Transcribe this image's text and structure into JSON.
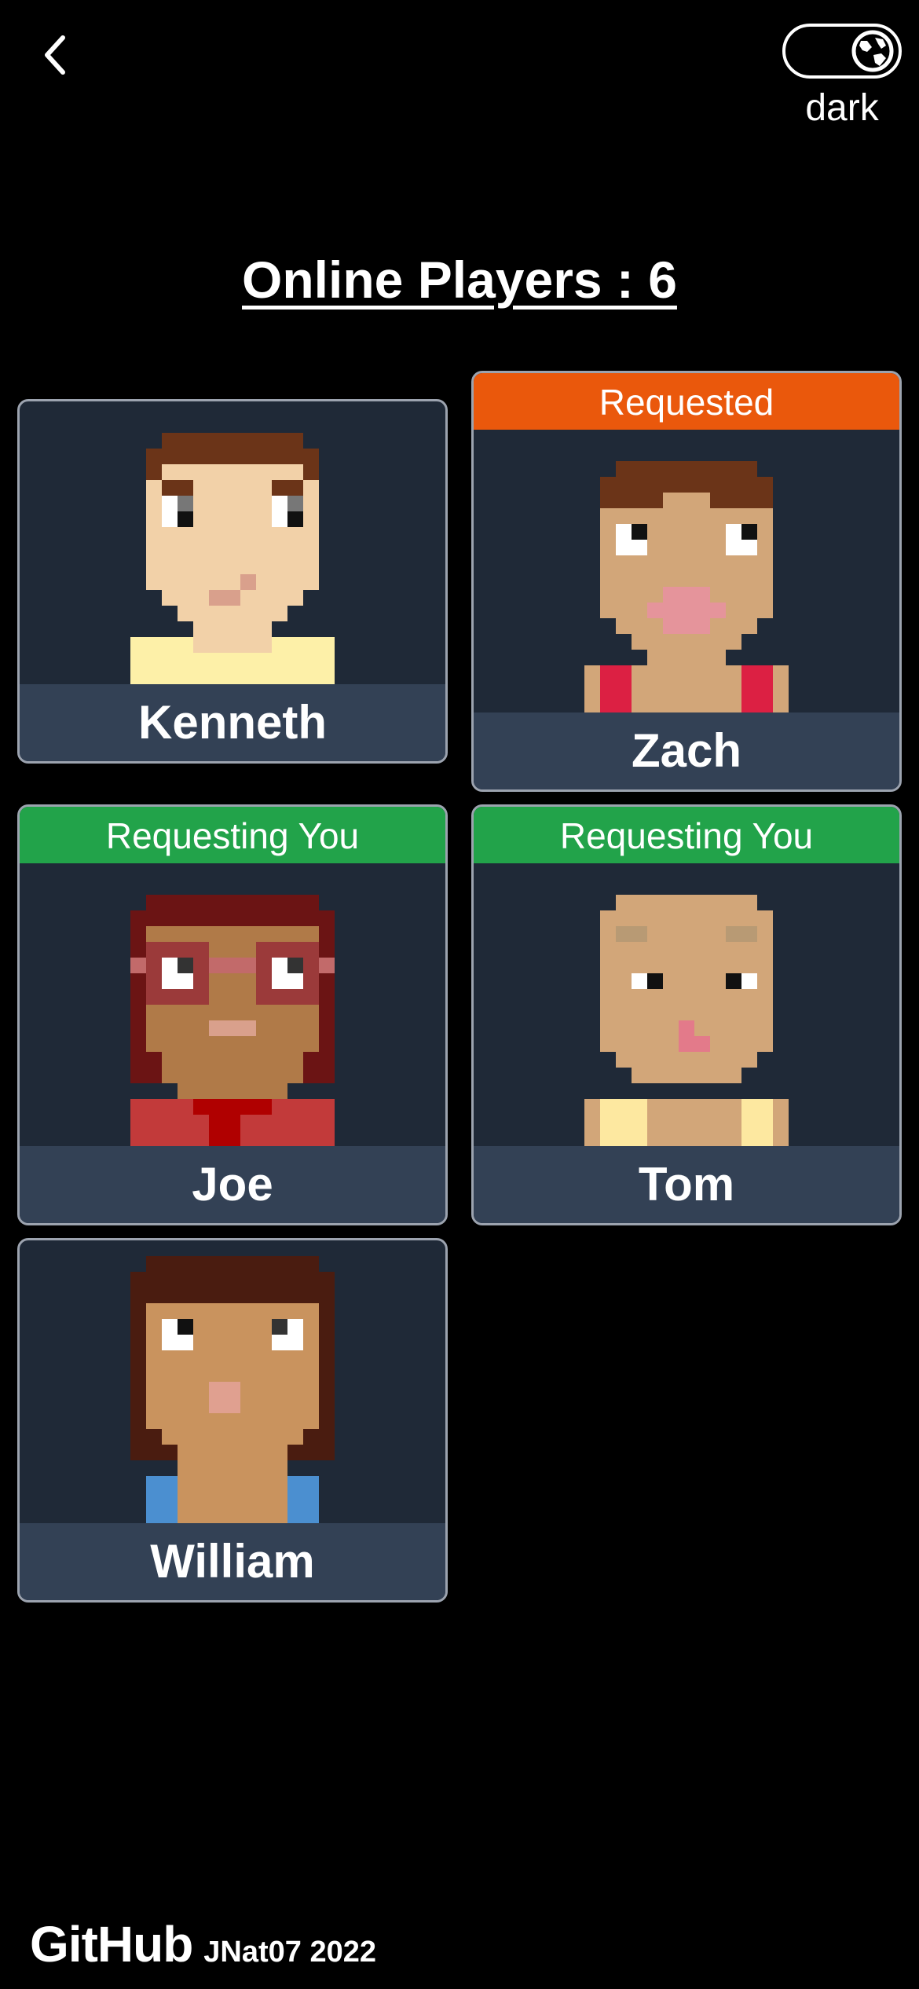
{
  "header": {
    "theme_label": "dark"
  },
  "title": "Online Players : 6",
  "colors": {
    "requested": "#ea580c",
    "requesting_you": "#22a34a",
    "card_bg": "#1f2937",
    "name_bg": "#334155"
  },
  "players": [
    {
      "name": "Kenneth",
      "status": ""
    },
    {
      "name": "Zach",
      "status": "Requested"
    },
    {
      "name": "Joe",
      "status": "Requesting You"
    },
    {
      "name": "Tom",
      "status": "Requesting You"
    },
    {
      "name": "William",
      "status": ""
    }
  ],
  "footer": {
    "brand": "GitHub",
    "credit": "JNat07 2022"
  }
}
